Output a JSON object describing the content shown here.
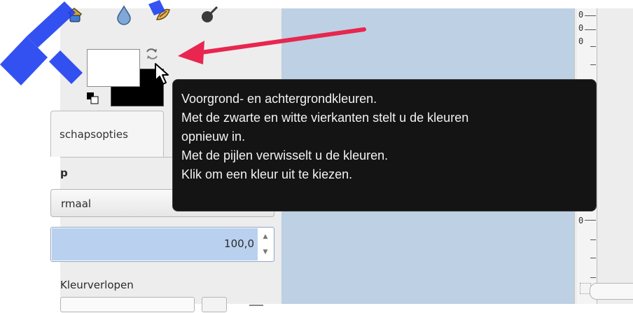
{
  "toolbox": {
    "tools": [
      {
        "name": "paint-bucket-icon"
      },
      {
        "name": "ink-drop-icon"
      },
      {
        "name": "smudge-icon"
      },
      {
        "name": "dodge-burn-icon"
      }
    ],
    "foreground_color": "#ffffff",
    "background_color": "#000000",
    "tab_label": "schapsopties",
    "mode_label": "p",
    "mode_value": "rmaal",
    "opacity_value": "100,0",
    "gradient_label": "Kleurverlopen"
  },
  "tooltip": {
    "lines": [
      "Voorgrond- en achtergrondkleuren.",
      "Met de zwarte en witte vierkanten stelt u de kleuren",
      "opnieuw in.",
      "Met de pijlen verwisselt u de kleuren.",
      "Klik om een kleur uit te kiezen."
    ]
  },
  "ruler": {
    "labels": [
      "0",
      "0",
      "0",
      "0"
    ]
  },
  "colors": {
    "canvas": "#bed0e3",
    "arrow": "#e8264f",
    "tooltip_bg": "#141414",
    "watermark": "#1e3ff0"
  }
}
